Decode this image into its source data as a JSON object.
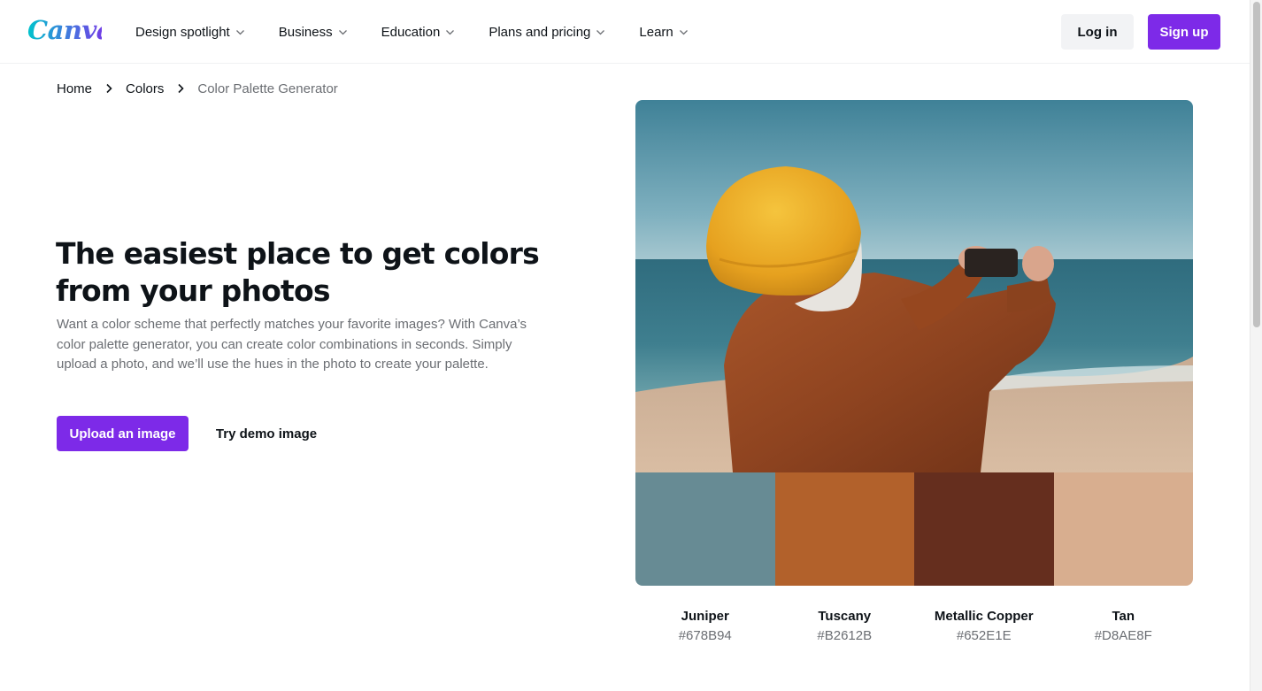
{
  "header": {
    "logo_text": "Canva",
    "nav": [
      {
        "label": "Design spotlight"
      },
      {
        "label": "Business"
      },
      {
        "label": "Education"
      },
      {
        "label": "Plans and pricing"
      },
      {
        "label": "Learn"
      }
    ],
    "login_label": "Log in",
    "signup_label": "Sign up"
  },
  "breadcrumb": {
    "items": [
      "Home",
      "Colors",
      "Color Palette Generator"
    ]
  },
  "hero": {
    "title": "The easiest place to get colors from your photos",
    "description": "Want a color scheme that perfectly matches your favorite images? With Canva’s color palette generator, you can create color combinations in seconds. Simply upload a photo, and we’ll use the hues in the photo to create your palette.",
    "upload_label": "Upload an image",
    "demo_label": "Try demo image"
  },
  "palette": [
    {
      "name": "Juniper",
      "hex": "#678B94"
    },
    {
      "name": "Tuscany",
      "hex": "#B2612B"
    },
    {
      "name": "Metallic Copper",
      "hex": "#652E1E"
    },
    {
      "name": "Tan",
      "hex": "#D8AE8F"
    }
  ],
  "colors": {
    "brand_purple": "#7d2ae8",
    "text_primary": "#0e1318",
    "text_muted": "#6b6e73"
  }
}
